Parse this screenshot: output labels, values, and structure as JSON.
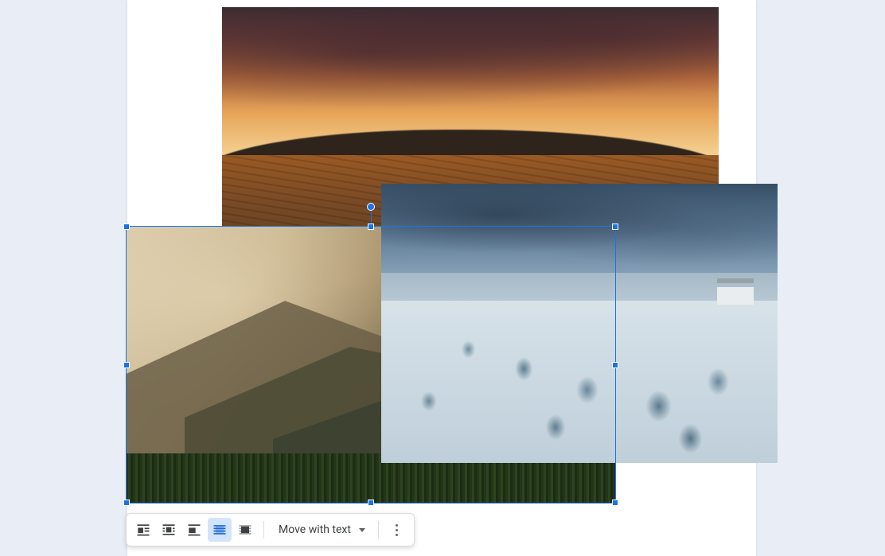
{
  "toolbar": {
    "options": {
      "inline": {
        "name": "In line",
        "active": false
      },
      "wrap": {
        "name": "Wrap text",
        "active": false
      },
      "break": {
        "name": "Break text",
        "active": false
      },
      "behind": {
        "name": "Behind text",
        "active": true
      },
      "front": {
        "name": "In front of text",
        "active": false
      }
    },
    "move_label": "Move with text",
    "more_label": "More image options"
  },
  "selection": {
    "target": "mountain-image",
    "handles": [
      "top-left",
      "top-middle",
      "top-right",
      "middle-left",
      "middle-right",
      "bottom-left",
      "bottom-middle",
      "bottom-right",
      "rotate"
    ]
  },
  "images": [
    {
      "id": "sunset-vineyard-image",
      "desc": "Vineyard at sunset with dramatic orange sky",
      "z": 1
    },
    {
      "id": "mountain-image",
      "desc": "Hazy layered mountains with forest foreground",
      "z": 2,
      "selected": true
    },
    {
      "id": "winter-image",
      "desc": "Frosted trees and snowy hills under grey-blue sky",
      "z": 3
    }
  ],
  "colors": {
    "selection": "#1a73e8",
    "toolbar_active_bg": "#d2e3fc"
  }
}
